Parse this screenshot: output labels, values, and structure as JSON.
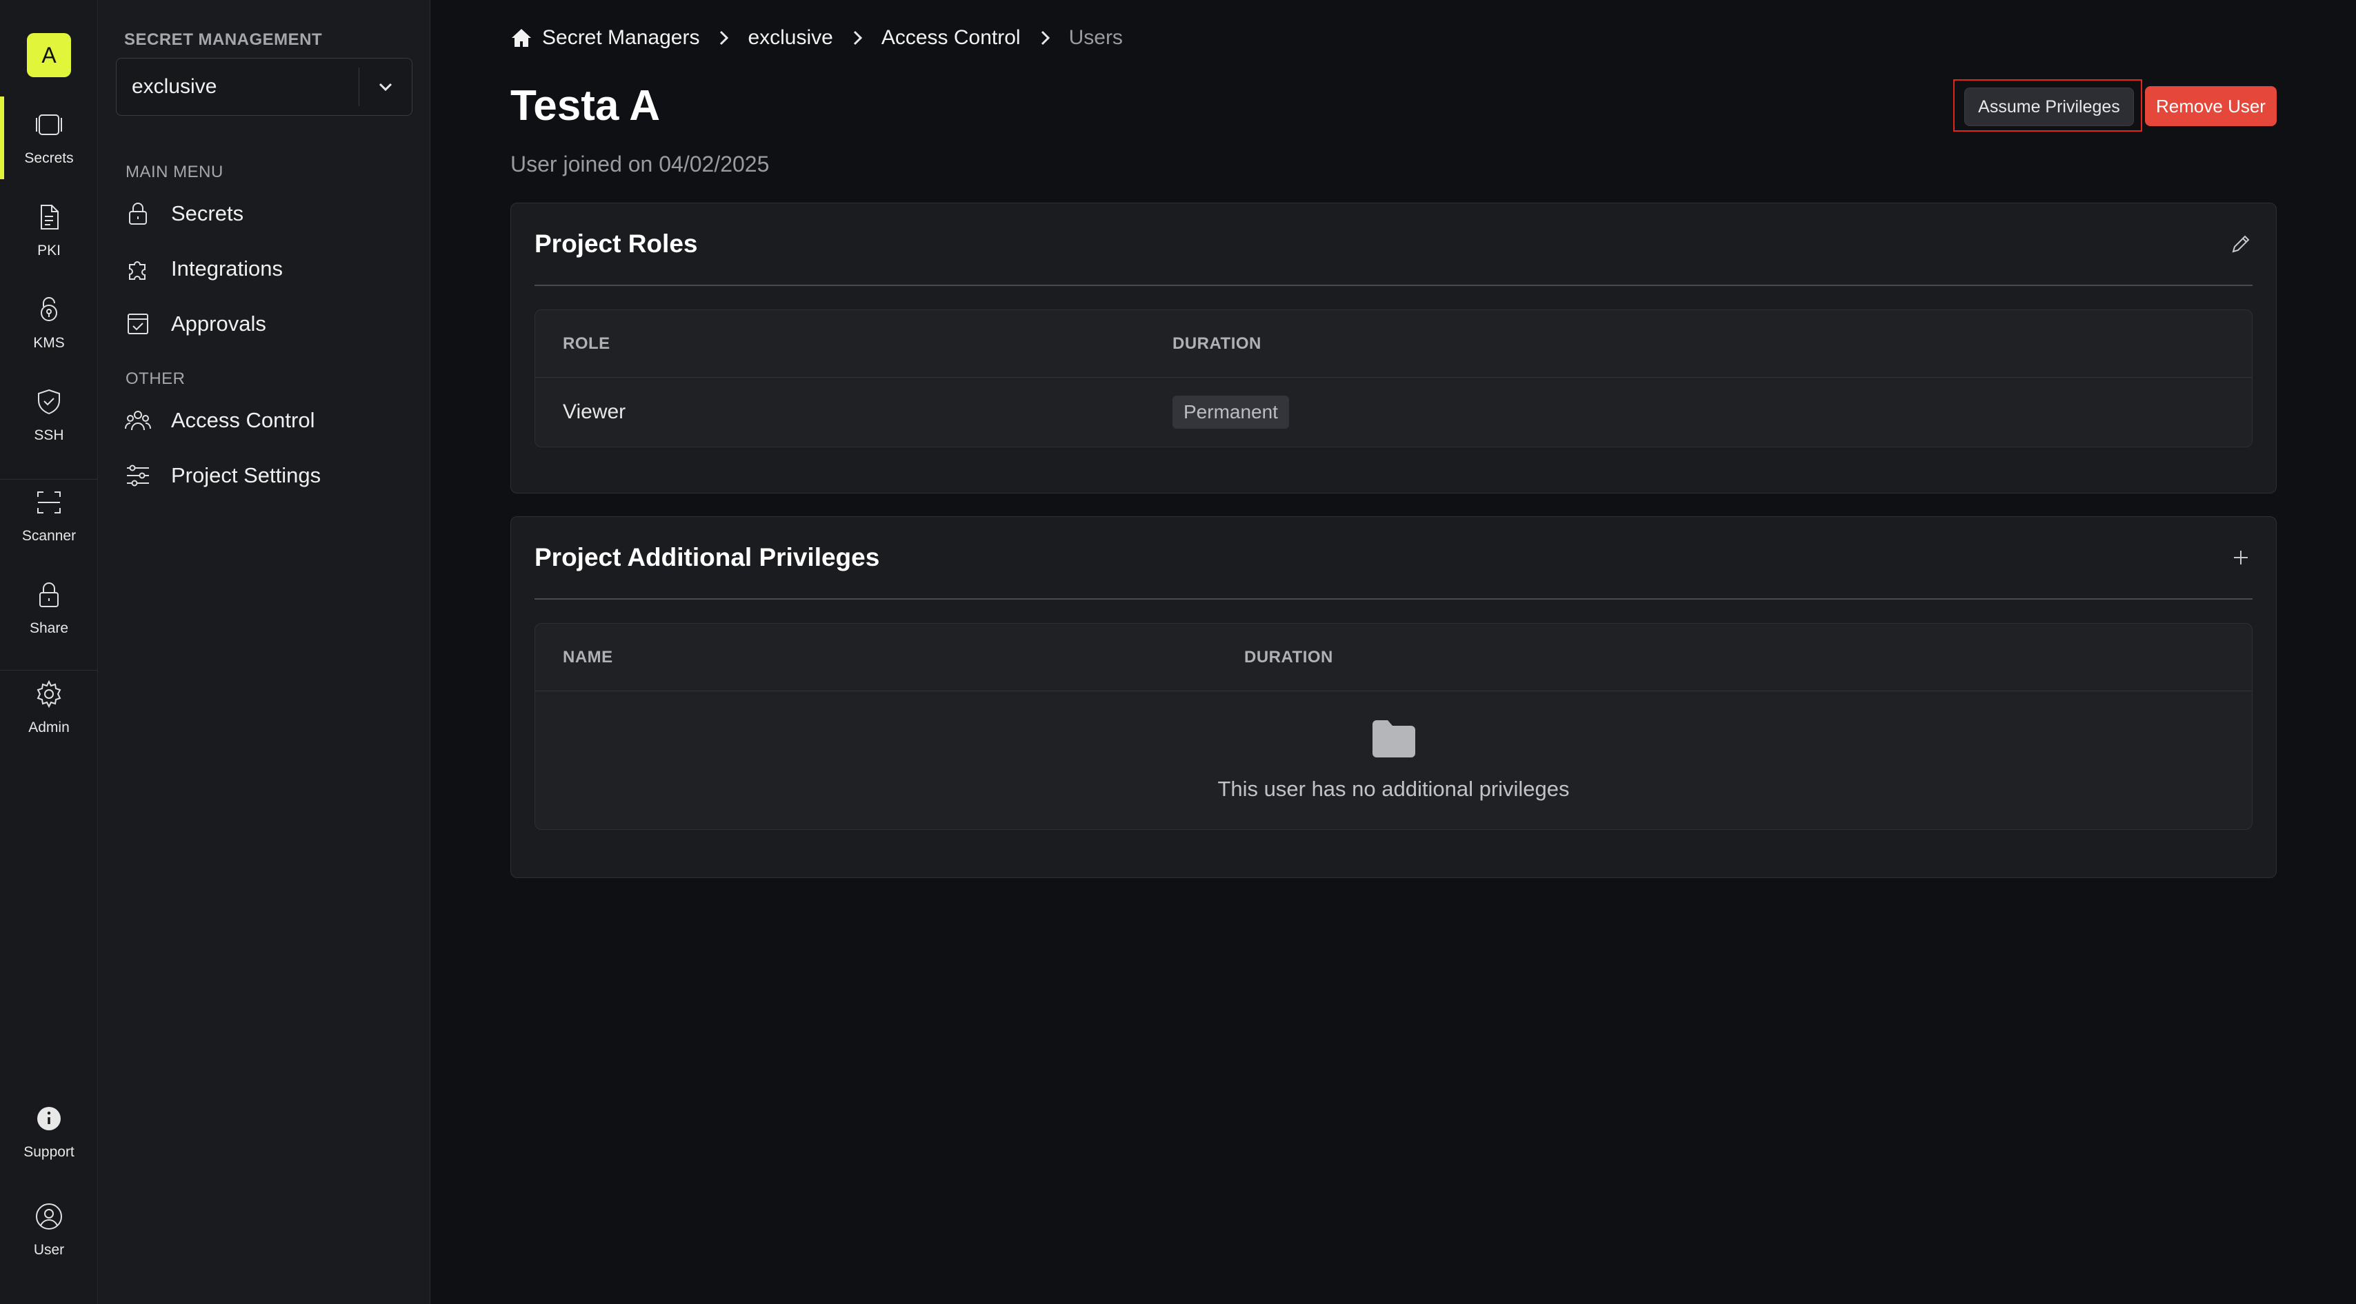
{
  "org": {
    "avatar_letter": "A"
  },
  "rail": {
    "items": [
      {
        "label": "Secrets",
        "icon": "vault-icon",
        "active": true
      },
      {
        "label": "PKI",
        "icon": "document-icon"
      },
      {
        "label": "KMS",
        "icon": "key-lock-icon"
      },
      {
        "label": "SSH",
        "icon": "shield-check-icon"
      },
      {
        "label": "Scanner",
        "icon": "scan-icon"
      },
      {
        "label": "Share",
        "icon": "lock-icon"
      },
      {
        "label": "Admin",
        "icon": "gear-icon"
      }
    ],
    "bottom": [
      {
        "label": "Support",
        "icon": "info-icon"
      },
      {
        "label": "User",
        "icon": "user-circle-icon"
      }
    ]
  },
  "sidebar": {
    "title": "SECRET MANAGEMENT",
    "project": "exclusive",
    "main_menu_label": "MAIN MENU",
    "main_menu": [
      {
        "label": "Secrets",
        "icon": "lock-icon"
      },
      {
        "label": "Integrations",
        "icon": "puzzle-icon"
      },
      {
        "label": "Approvals",
        "icon": "checkbox-icon"
      }
    ],
    "other_label": "OTHER",
    "other": [
      {
        "label": "Access Control",
        "icon": "users-icon"
      },
      {
        "label": "Project Settings",
        "icon": "sliders-icon"
      }
    ]
  },
  "breadcrumb": [
    "Secret Managers",
    "exclusive",
    "Access Control",
    "Users"
  ],
  "page": {
    "title": "Testa A",
    "joined": "User joined on 04/02/2025",
    "assume_button": "Assume Privileges",
    "remove_button": "Remove User"
  },
  "roles": {
    "title": "Project Roles",
    "columns": [
      "ROLE",
      "DURATION"
    ],
    "rows": [
      {
        "role": "Viewer",
        "duration": "Permanent"
      }
    ]
  },
  "privileges": {
    "title": "Project Additional Privileges",
    "columns": [
      "NAME",
      "DURATION"
    ],
    "empty_message": "This user has no additional privileges"
  }
}
